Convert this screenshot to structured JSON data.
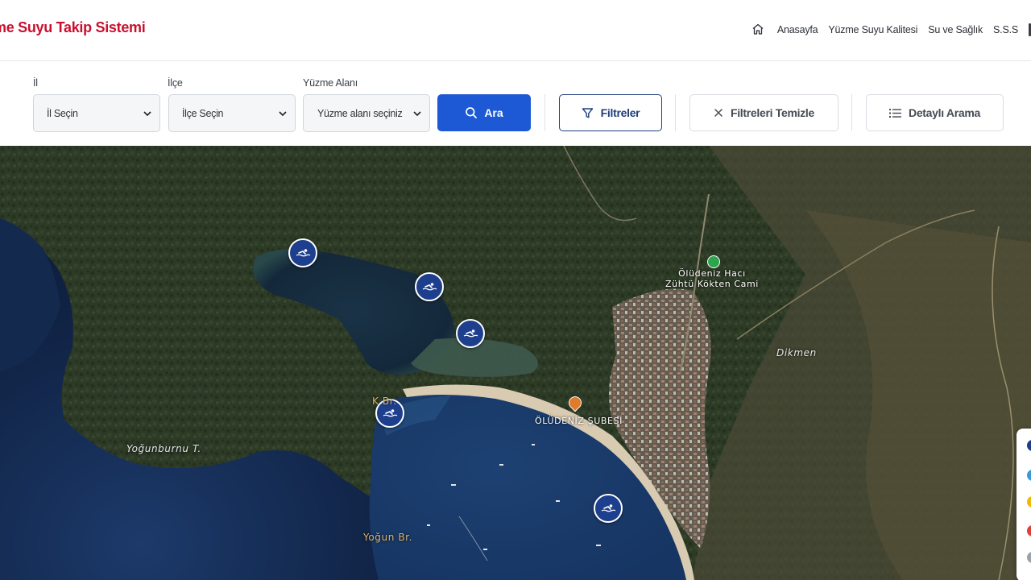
{
  "header": {
    "brand": "me Suyu Takip Sistemi",
    "nav": [
      {
        "label": "Anasayfa"
      },
      {
        "label": "Yüzme Suyu Kalitesi"
      },
      {
        "label": "Su ve Sağlık"
      },
      {
        "label": "S.S.S"
      }
    ]
  },
  "filters": {
    "il": {
      "label": "İl",
      "value": "İl Seçin"
    },
    "ilce": {
      "label": "İlçe",
      "value": "İlçe Seçin"
    },
    "alan": {
      "label": "Yüzme Alanı",
      "value": "Yüzme alanı seçiniz"
    },
    "search_label": "Ara",
    "filter_label": "Filtreler",
    "clear_label": "Filtreleri Temizle",
    "detail_label": "Detaylı Arama"
  },
  "map": {
    "labels": {
      "dikmen": "Dikmen",
      "yogunburnu": "Yoğunburnu T.",
      "yogun_br": "Yoğun Br.",
      "k_br": "K   Br.",
      "cami_line1": "Ölüdeniz Hacı",
      "cami_line2": "Zühtü Kökten Cami",
      "sube": "ÖLÜDENİZ ŞUBESİ"
    },
    "legend_colors": [
      "#1d3f8e",
      "#3a9ad9",
      "#f2b705",
      "#e0403a",
      "#9aa3ad"
    ]
  }
}
